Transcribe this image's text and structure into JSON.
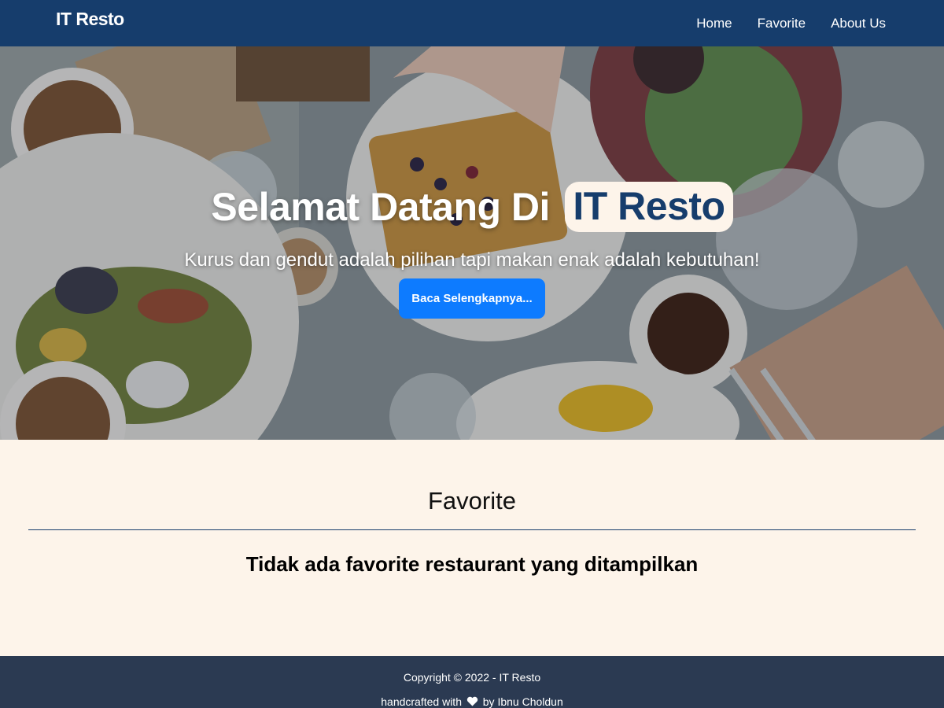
{
  "navbar": {
    "brand": "IT Resto",
    "links": [
      {
        "label": "Home"
      },
      {
        "label": "Favorite"
      },
      {
        "label": "About Us"
      }
    ]
  },
  "hero": {
    "title_prefix": "Selamat Datang Di",
    "title_highlight": "IT Resto",
    "subtitle": "Kurus dan gendut adalah pilihan tapi makan enak adalah kebutuhan!",
    "button_label": "Baca Selengkapnya..."
  },
  "favorite": {
    "heading": "Favorite",
    "empty_message": "Tidak ada favorite restaurant yang ditampilkan"
  },
  "footer": {
    "copyright": "Copyright © 2022 - IT Resto",
    "credit_prefix": "handcrafted with",
    "credit_icon": "heart-icon",
    "credit_suffix": "by Ibnu Choldun"
  },
  "colors": {
    "navbar": "#163d6c",
    "accent_button": "#0d7bff",
    "page_background": "#fdf4ea",
    "footer": "#2b3a52"
  }
}
